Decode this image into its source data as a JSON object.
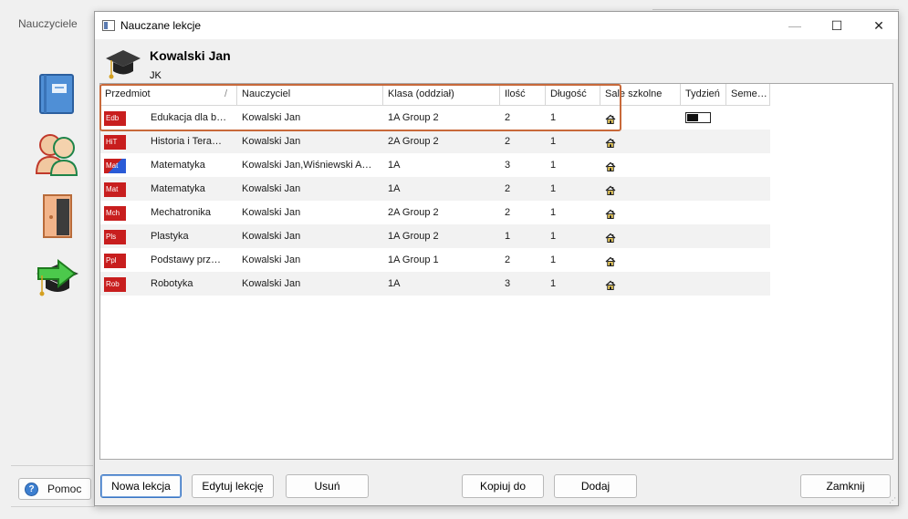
{
  "background": {
    "window_title": "Nauczyciele",
    "help_label": "Pomoc",
    "help_icon": "?"
  },
  "dialog": {
    "title": "Nauczane lekcje",
    "controls": {
      "minimize": "—",
      "maximize": "☐",
      "close": "✕"
    },
    "teacher": {
      "name": "Kowalski Jan",
      "abbr": "JK"
    },
    "columns": [
      "Przedmiot",
      "Nauczyciel",
      "Klasa (oddział)",
      "Ilość",
      "Długość",
      "Sale szkolne",
      "Tydzień",
      "Seme…"
    ],
    "rows": [
      {
        "badge": "Edb",
        "badge_color": "#c81e1e",
        "subject": "Edukacja dla b…",
        "teacher": "Kowalski Jan",
        "class": "1A Group 2",
        "count": "2",
        "length": "1",
        "room_icon": "house-icon",
        "week_toggle": true
      },
      {
        "badge": "HiT",
        "badge_color": "#c81e1e",
        "subject": "Historia i Tera…",
        "teacher": "Kowalski Jan",
        "class": "2A Group 2",
        "count": "2",
        "length": "1",
        "room_icon": "house-icon",
        "week_toggle": false
      },
      {
        "badge": "Mat",
        "badge_color": "split-red-blue",
        "subject": "Matematyka",
        "teacher": "Kowalski Jan,Wiśniewski A…",
        "class": "1A",
        "count": "3",
        "length": "1",
        "room_icon": "house-icon",
        "week_toggle": false
      },
      {
        "badge": "Mat",
        "badge_color": "#c81e1e",
        "subject": "Matematyka",
        "teacher": "Kowalski Jan",
        "class": "1A",
        "count": "2",
        "length": "1",
        "room_icon": "house-icon",
        "week_toggle": false
      },
      {
        "badge": "Mch",
        "badge_color": "#c81e1e",
        "subject": "Mechatronika",
        "teacher": "Kowalski Jan",
        "class": "2A Group 2",
        "count": "2",
        "length": "1",
        "room_icon": "house-icon",
        "week_toggle": false
      },
      {
        "badge": "Pls",
        "badge_color": "#c81e1e",
        "subject": "Plastyka",
        "teacher": "Kowalski Jan",
        "class": "1A Group 2",
        "count": "1",
        "length": "1",
        "room_icon": "house-icon",
        "week_toggle": false
      },
      {
        "badge": "Ppl",
        "badge_color": "#c81e1e",
        "subject": "Podstawy prz…",
        "teacher": "Kowalski Jan",
        "class": "1A Group 1",
        "count": "2",
        "length": "1",
        "room_icon": "house-icon",
        "week_toggle": false
      },
      {
        "badge": "Rob",
        "badge_color": "#c81e1e",
        "subject": "Robotyka",
        "teacher": "Kowalski Jan",
        "class": "1A",
        "count": "3",
        "length": "1",
        "room_icon": "house-icon",
        "week_toggle": false
      }
    ],
    "buttons": {
      "new": "Nowa lekcja",
      "edit": "Edytuj lekcję",
      "delete": "Usuń",
      "copy": "Kopiuj do",
      "add": "Dodaj",
      "close": "Zamknij"
    },
    "highlight_color": "#c8693a"
  }
}
